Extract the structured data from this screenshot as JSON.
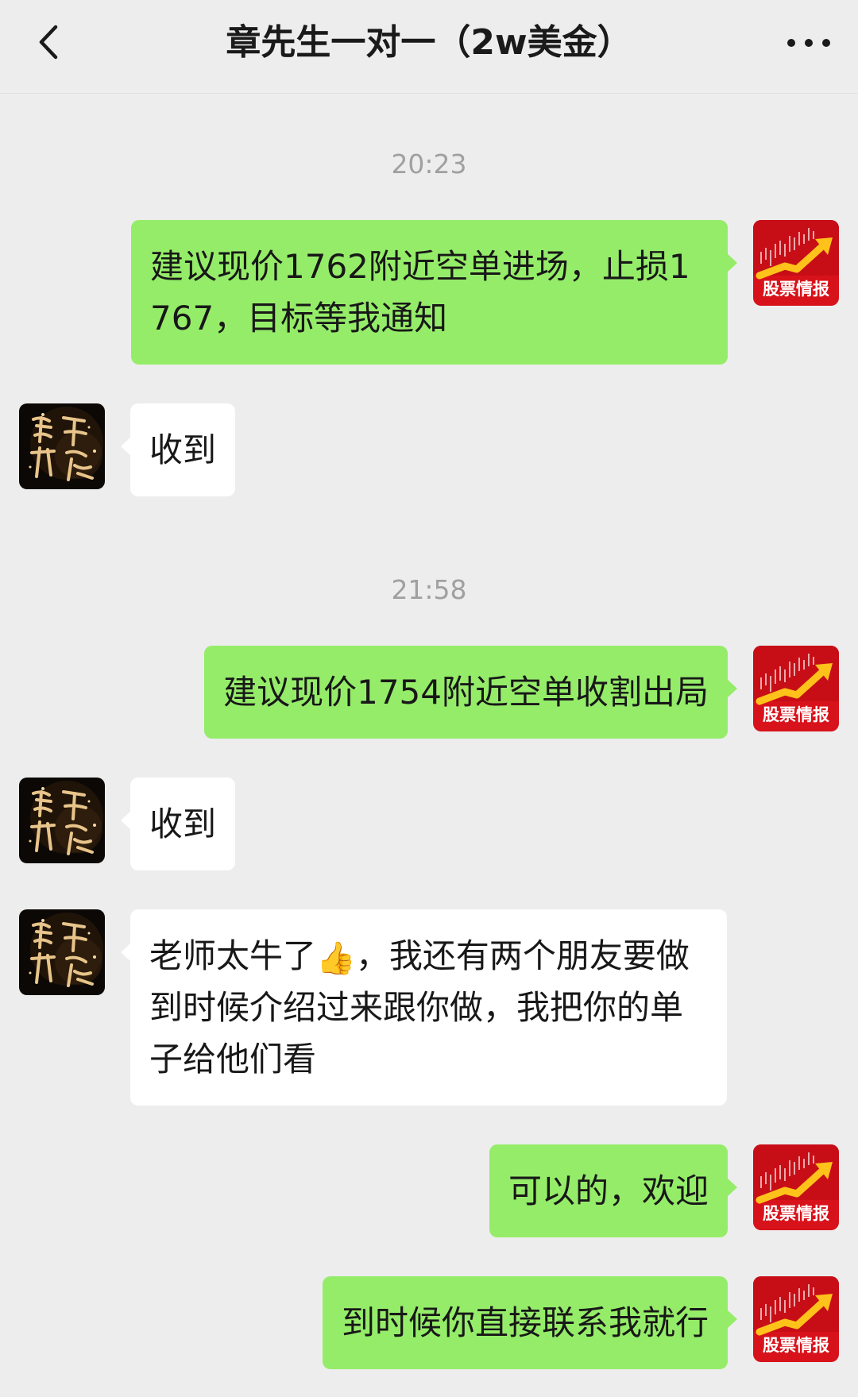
{
  "header": {
    "title": "章先生一对一（2w美金）"
  },
  "icons": {
    "back": "chevron-left-icon",
    "more": "more-dots-icon",
    "self_avatar": "stock-news-avatar",
    "contact_avatar": "calligraphy-avatar"
  },
  "self_avatar_label": "股票情报",
  "colors": {
    "background": "#ededed",
    "my_bubble": "#95ec69",
    "their_bubble": "#ffffff",
    "time_text": "#a0a0a0",
    "avatar_red": "#d8121b",
    "avatar_arrow": "#ffc21a"
  },
  "chat": {
    "time_1": "20:23",
    "msg_1": "建议现价1762附近空单进场，止损1767，目标等我通知",
    "msg_2": "收到",
    "time_2": "21:58",
    "msg_3": "建议现价1754附近空单收割出局",
    "msg_4": "收到",
    "msg_5_part_a": "老师太牛了",
    "msg_5_emoji": "👍",
    "msg_5_part_b": "，我还有两个朋友要做到时候介绍过来跟你做，我把你的单子给他们看",
    "msg_6": "可以的，欢迎",
    "msg_7": "到时候你直接联系我就行"
  }
}
